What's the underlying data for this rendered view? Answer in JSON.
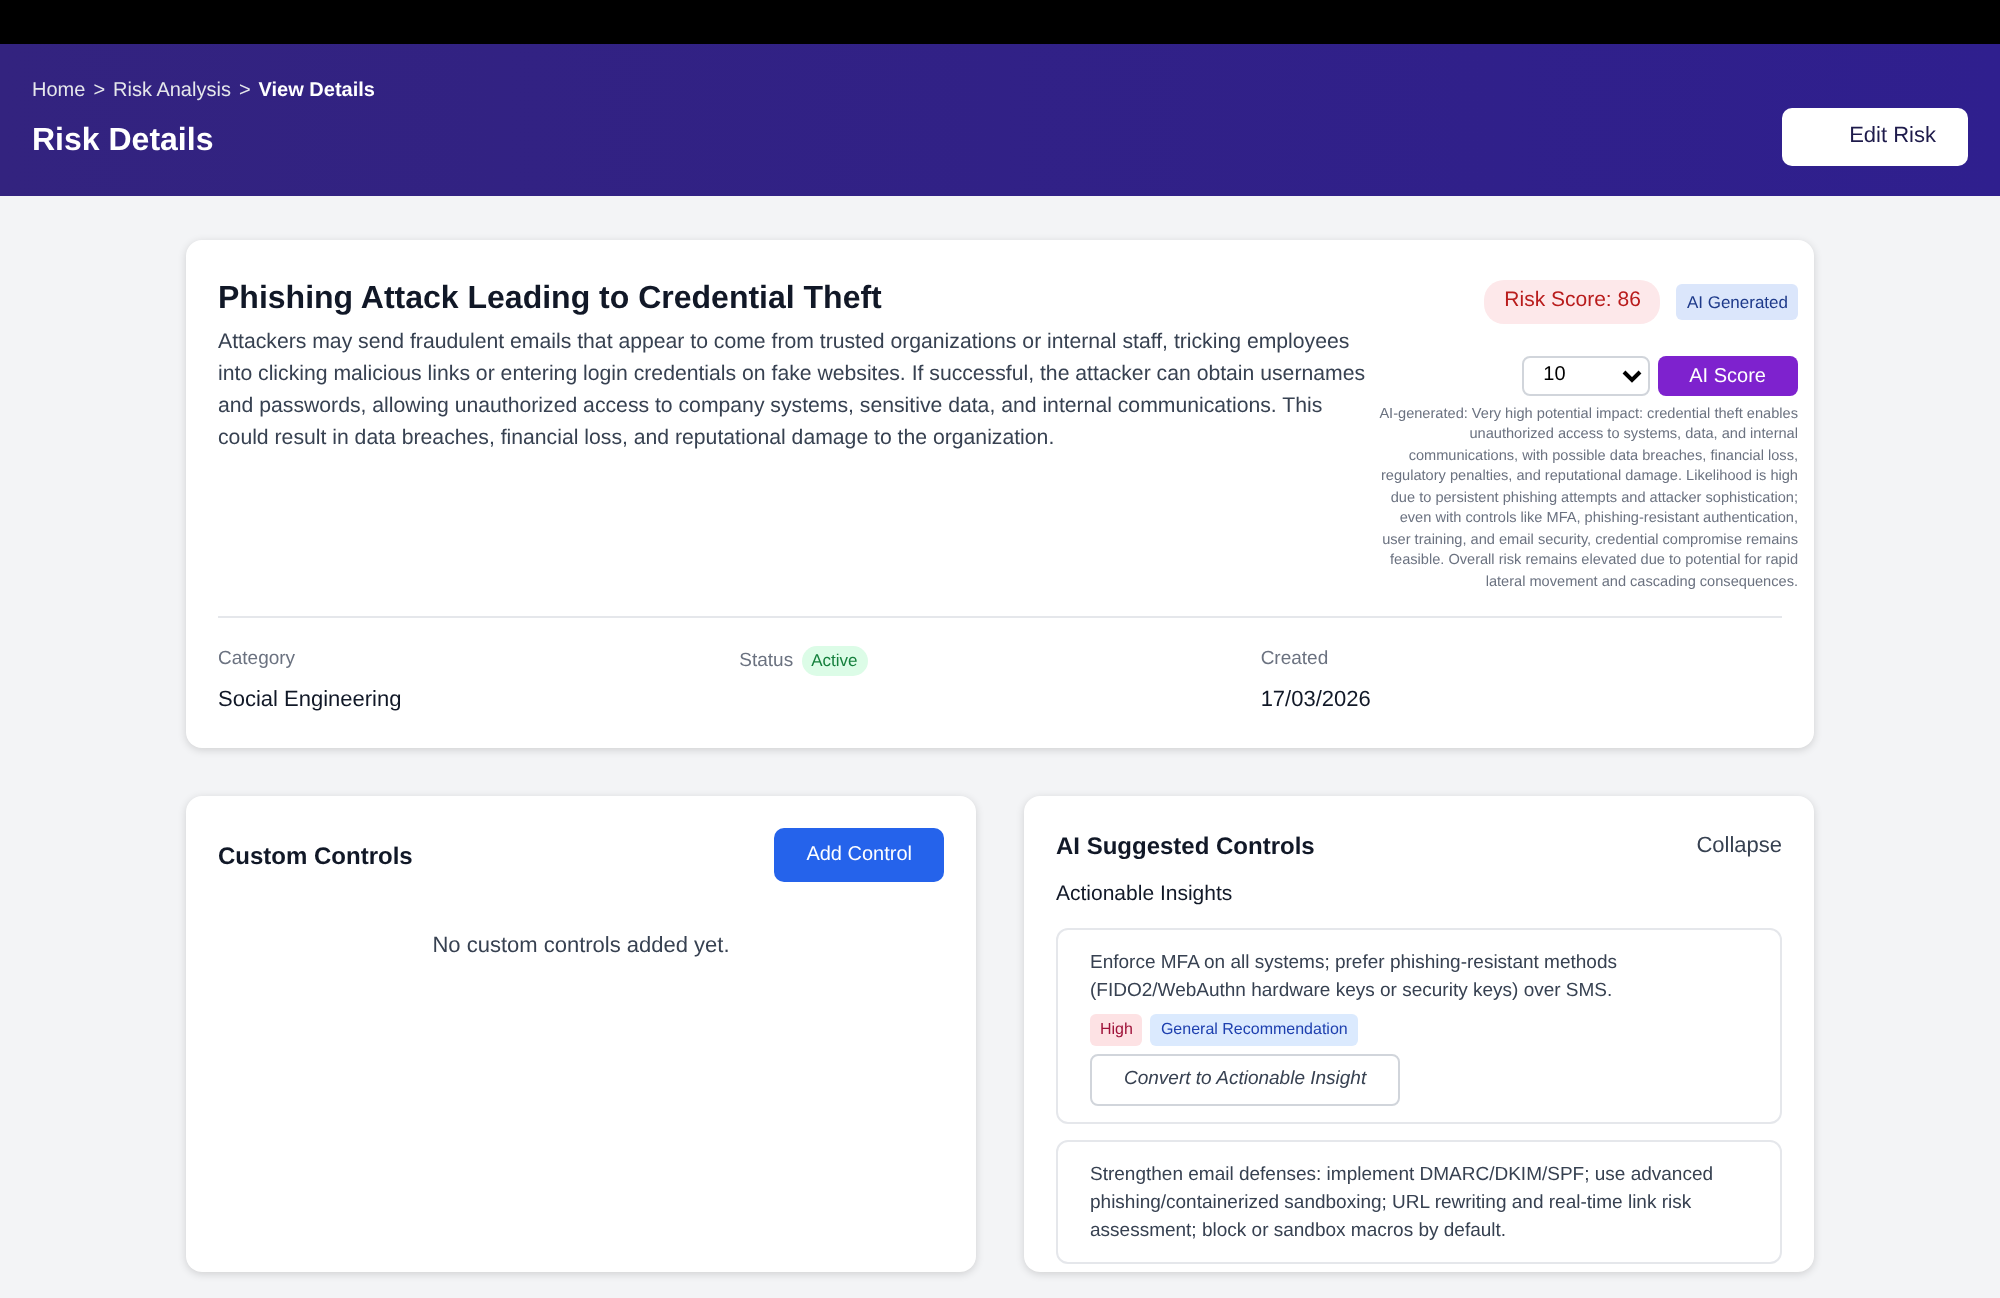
{
  "breadcrumb": [
    {
      "label": "Home",
      "current": false
    },
    {
      "label": "Risk Analysis",
      "current": false
    },
    {
      "label": "View Details",
      "current": true
    }
  ],
  "breadcrumb_separator": ">",
  "page_title": "Risk Details",
  "edit_button": "Edit Risk",
  "risk": {
    "title": "Phishing Attack Leading to Credential Theft",
    "description": "Attackers may send fraudulent emails that appear to come from trusted organizations or internal staff, tricking employees into clicking malicious links or entering login credentials on fake websites. If successful, the attacker can obtain usernames and passwords, allowing unauthorized access to company systems, sensitive data, and internal communications. This could result in data breaches, financial loss, and reputational damage to the organization.",
    "risk_score": "Risk Score: 86",
    "ai_badge": "AI Generated",
    "score_select": "10",
    "ai_score_button": "AI Score",
    "ai_rationale": "AI-generated: Very high potential impact: credential theft enables unauthorized access to systems, data, and internal communications, with possible data breaches, financial loss, regulatory penalties, and reputational damage. Likelihood is high due to persistent phishing attempts and attacker sophistication; even with controls like MFA, phishing-resistant authentication, user training, and email security, credential compromise remains feasible. Overall risk remains elevated due to potential for rapid lateral movement and cascading consequences.",
    "fields": [
      {
        "label": "Category",
        "value": "Social Engineering",
        "kind": "text"
      },
      {
        "label": "Status",
        "value": "Active",
        "kind": "badge"
      },
      {
        "label": "Created",
        "value": "17/03/2026",
        "kind": "text"
      }
    ]
  },
  "custom_controls": {
    "title": "Custom Controls",
    "add_button": "Add Control",
    "empty_text": "No custom controls added yet."
  },
  "ai_controls": {
    "title": "AI Suggested Controls",
    "collapse_link": "Collapse",
    "subtitle": "Actionable Insights",
    "insights": [
      {
        "text": "Enforce MFA on all systems; prefer phishing-resistant methods (FIDO2/WebAuthn hardware keys or security keys) over SMS.",
        "priority": "High",
        "tag": "General Recommendation",
        "button": "Convert to Actionable Insight"
      },
      {
        "text": "Strengthen email defenses: implement DMARC/DKIM/SPF; use advanced phishing/containerized sandboxing; URL rewriting and real-time link risk assessment; block or sandbox macros by default."
      }
    ]
  }
}
